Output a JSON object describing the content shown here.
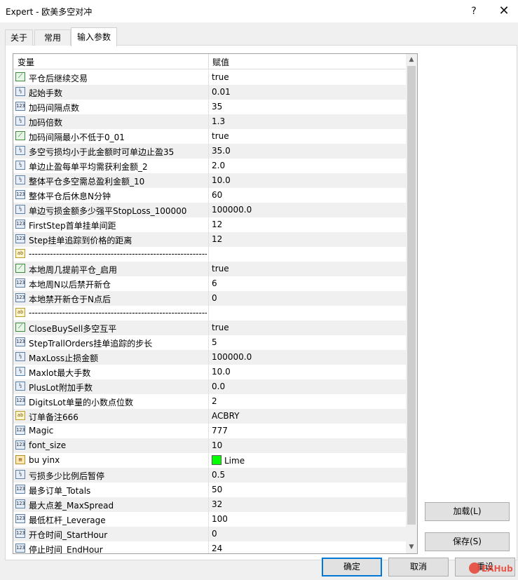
{
  "window": {
    "title": "Expert - 欧美多空对冲",
    "help": "?",
    "close": "✕"
  },
  "tabs": [
    {
      "label": "关于"
    },
    {
      "label": "常用"
    },
    {
      "label": "输入参数"
    }
  ],
  "grid": {
    "header": {
      "variable": "变量",
      "value": "赋值"
    },
    "rows": [
      {
        "type": "bool",
        "name": "平仓后继续交易",
        "value": "true"
      },
      {
        "type": "double",
        "name": "起始手数",
        "value": "0.01"
      },
      {
        "type": "int",
        "name": "加码间隔点数",
        "value": "35"
      },
      {
        "type": "double",
        "name": "加码倍数",
        "value": "1.3"
      },
      {
        "type": "bool",
        "name": "加码间隔最小不低于0_01",
        "value": "true"
      },
      {
        "type": "double",
        "name": "多空亏损均小于此金额时可单边止盈35",
        "value": "35.0"
      },
      {
        "type": "double",
        "name": "单边止盈每单平均需获利金额_2",
        "value": "2.0"
      },
      {
        "type": "double",
        "name": "整体平仓多空需总盈利金额_10",
        "value": "10.0"
      },
      {
        "type": "int",
        "name": "整体平仓后休息N分钟",
        "value": "60"
      },
      {
        "type": "double",
        "name": "单边亏损金额多少强平StopLoss_100000",
        "value": "100000.0"
      },
      {
        "type": "int",
        "name": "FirstStep首单挂单间距",
        "value": "12"
      },
      {
        "type": "int",
        "name": "Step挂单追踪到价格的距离",
        "value": "12"
      },
      {
        "type": "string",
        "name": "--------------------------------------------------------------------------",
        "value": ""
      },
      {
        "type": "bool",
        "name": "本地周几提前平仓_启用",
        "value": "true"
      },
      {
        "type": "int",
        "name": "本地周N以后禁开新仓",
        "value": "6"
      },
      {
        "type": "int",
        "name": "本地禁开新仓于N点后",
        "value": "0"
      },
      {
        "type": "string",
        "name": "--------------------------------------------------------------------------",
        "value": ""
      },
      {
        "type": "bool",
        "name": "CloseBuySell多空互平",
        "value": "true"
      },
      {
        "type": "int",
        "name": "StepTrallOrders挂单追踪的步长",
        "value": "5"
      },
      {
        "type": "double",
        "name": "MaxLoss止损金额",
        "value": "100000.0"
      },
      {
        "type": "double",
        "name": "Maxlot最大手数",
        "value": "10.0"
      },
      {
        "type": "double",
        "name": "PlusLot附加手数",
        "value": "0.0"
      },
      {
        "type": "int",
        "name": "DigitsLot单量的小数点位数",
        "value": "2"
      },
      {
        "type": "string",
        "name": "订单备注666",
        "value": "ACBRY"
      },
      {
        "type": "int",
        "name": "Magic",
        "value": "777"
      },
      {
        "type": "int",
        "name": "font_size",
        "value": "10"
      },
      {
        "type": "color",
        "name": "bu yinx",
        "value": "Lime",
        "swatch": "#00ff00"
      },
      {
        "type": "double",
        "name": "亏损多少比例后暂停",
        "value": "0.5"
      },
      {
        "type": "int",
        "name": "最多订单_Totals",
        "value": "50"
      },
      {
        "type": "int",
        "name": "最大点差_MaxSpread",
        "value": "32"
      },
      {
        "type": "int",
        "name": "最低杠杆_Leverage",
        "value": "100"
      },
      {
        "type": "int",
        "name": "开仓时间_StartHour",
        "value": "0"
      },
      {
        "type": "int",
        "name": "停止时间_EndHour",
        "value": "24"
      }
    ]
  },
  "buttons": {
    "load": "加载(L)",
    "save": "保存(S)",
    "ok": "确定",
    "cancel": "取消",
    "reset": "重设"
  },
  "watermark": "EAHub",
  "icons": {
    "bool": "chart-line-icon",
    "int": "integer-icon",
    "double": "double-icon",
    "string": "string-icon",
    "color": "color-icon"
  }
}
